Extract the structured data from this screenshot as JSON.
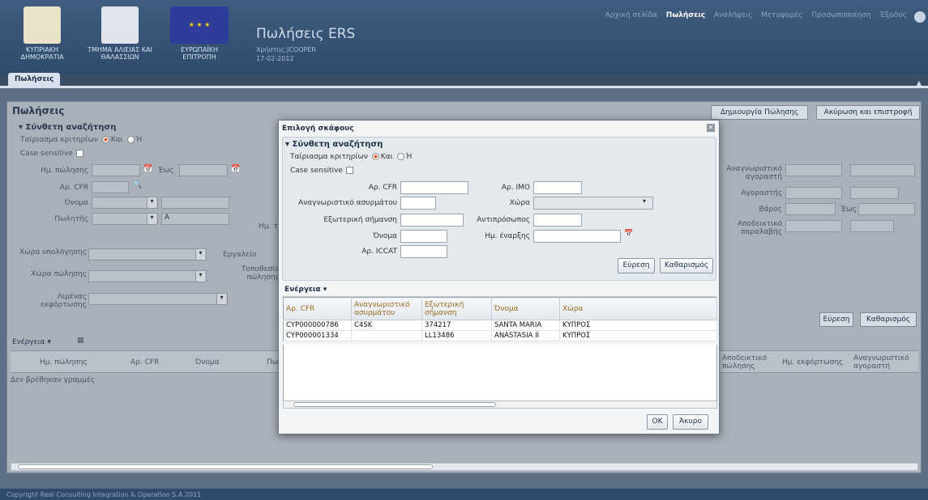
{
  "header": {
    "logos": [
      {
        "name": "ΚΥΠΡΙΑΚΗ ΔΗΜΟΚΡΑΤΙΑ",
        "line1": "ΚΥΠΡΙΑΚΗ",
        "line2": "ΔΗΜΟΚΡΑΤΙΑ"
      },
      {
        "name": "ΤΜΗΜΑ ΑΛΙΕΙΑΣ ΚΑΙ ΘΑΛΑΣΣΙΩΝ",
        "line1": "ΤΜΗΜΑ ΑΛΙΕΙΑΣ ΚΑΙ",
        "line2": "ΘΑΛΑΣΣΙΩΝ"
      },
      {
        "name": "ΕΥΡΩΠΑΪΚΗ ΕΠΙΤΡΟΠΗ",
        "line1": "ΕΥΡΩΠΑΪΚΗ",
        "line2": "ΕΠΙΤΡΟΠΗ"
      }
    ],
    "app_title": "Πωλήσεις ERS",
    "user": "Χρήστης:JCOOPER",
    "date": "17-02-2012",
    "nav": [
      "Αρχική σελίδα",
      "Πωλήσεις",
      "Αναλήψεις",
      "Μεταφορές",
      "Προσωποποίηση",
      "Έξοδος"
    ],
    "active_nav": "Πωλήσεις",
    "tab": "Πωλήσεις"
  },
  "main": {
    "title": "Πωλήσεις",
    "create_button": "Δημιουργία Πώλησης",
    "cancel_button": "Ακύρωση και επιστροφή",
    "search_section": "Σύνθετη αναζήτηση",
    "match_label": "Ταίριασμα κριτηρίων",
    "and": "Και",
    "or": "Ή",
    "case_sensitive": "Case sensitive",
    "fields": {
      "sale_date": "Ημ. πώλησης",
      "to": "Έως",
      "cfr": "Αρ. CFR",
      "name": "Όνομα",
      "seller": "Πωλητής",
      "seller_value": "A",
      "calc_country": "Χώρα υπολόγησης",
      "tool": "Εργαλείο",
      "sale_country": "Χώρα πώλησης",
      "sale_location": "Τοποθεσία πώλησης",
      "unload_port": "Λιμένας εκφόρτωσης",
      "buyer_id": "Αναγνωριστικό αγοραστή",
      "buyer": "Αγοραστής",
      "weight": "Βάρος",
      "weight_to": "Έως",
      "receipt_proof": "Αποδεικτικό παραλαβής",
      "partial_date": "Ημ. τ"
    },
    "search_button": "Εύρεση",
    "clear_button": "Καθαρισμός",
    "actions_menu": "Ενέργεια",
    "columns": [
      "Ημ. πώλησης",
      "Αρ. CFR",
      "Όνομα",
      "Πω"
    ],
    "columns_right": [
      "Αποδεικτικό πώλησης",
      "Ημ. εκφόρτωσης",
      "Αναγνωριστικό αγοραστή"
    ],
    "empty_text": "Δεν βρέθηκαν γραμμές"
  },
  "dialog": {
    "title": "Επιλογή σκάφους",
    "section": "Σύνθετη αναζήτηση",
    "match_label": "Ταίριασμα κριτηρίων",
    "and": "Και",
    "or": "Ή",
    "case_sensitive": "Case sensitive",
    "labels": {
      "cfr": "Αρ. CFR",
      "imo": "Αρ. IMO",
      "radio_id": "Αναγνωριστικό ασυρμάτου",
      "country": "Χώρα",
      "ext_mark": "Εξωτερική σήμανση",
      "representative": "Αντιπρόσωπος",
      "name": "Όνομα",
      "start_date": "Ημ. έναρξης",
      "iccat": "Αρ. ICCAT"
    },
    "search_button": "Εύρεση",
    "clear_button": "Καθαρισμός",
    "actions_menu": "Ενέργεια",
    "columns": [
      "Αρ. CFR",
      "Αναγνωριστικό ασυρμάτου",
      "Εξωτερική σήμανση",
      "Όνομα",
      "Χώρα"
    ],
    "rows": [
      {
        "cfr": "CYP000000786",
        "radio": "C4SK",
        "mark": "374217",
        "name": "SANTA MARIA",
        "country": "ΚΥΠΡΟΣ"
      },
      {
        "cfr": "CYP000001334",
        "radio": "",
        "mark": "LL13486",
        "name": "ANASTASIA II",
        "country": "ΚΥΠΡΟΣ"
      }
    ],
    "ok_button": "OK",
    "cancel_button": "Άκυρο"
  },
  "footer": "Copyright Real Consulting Integration & Operation S.A 2011"
}
